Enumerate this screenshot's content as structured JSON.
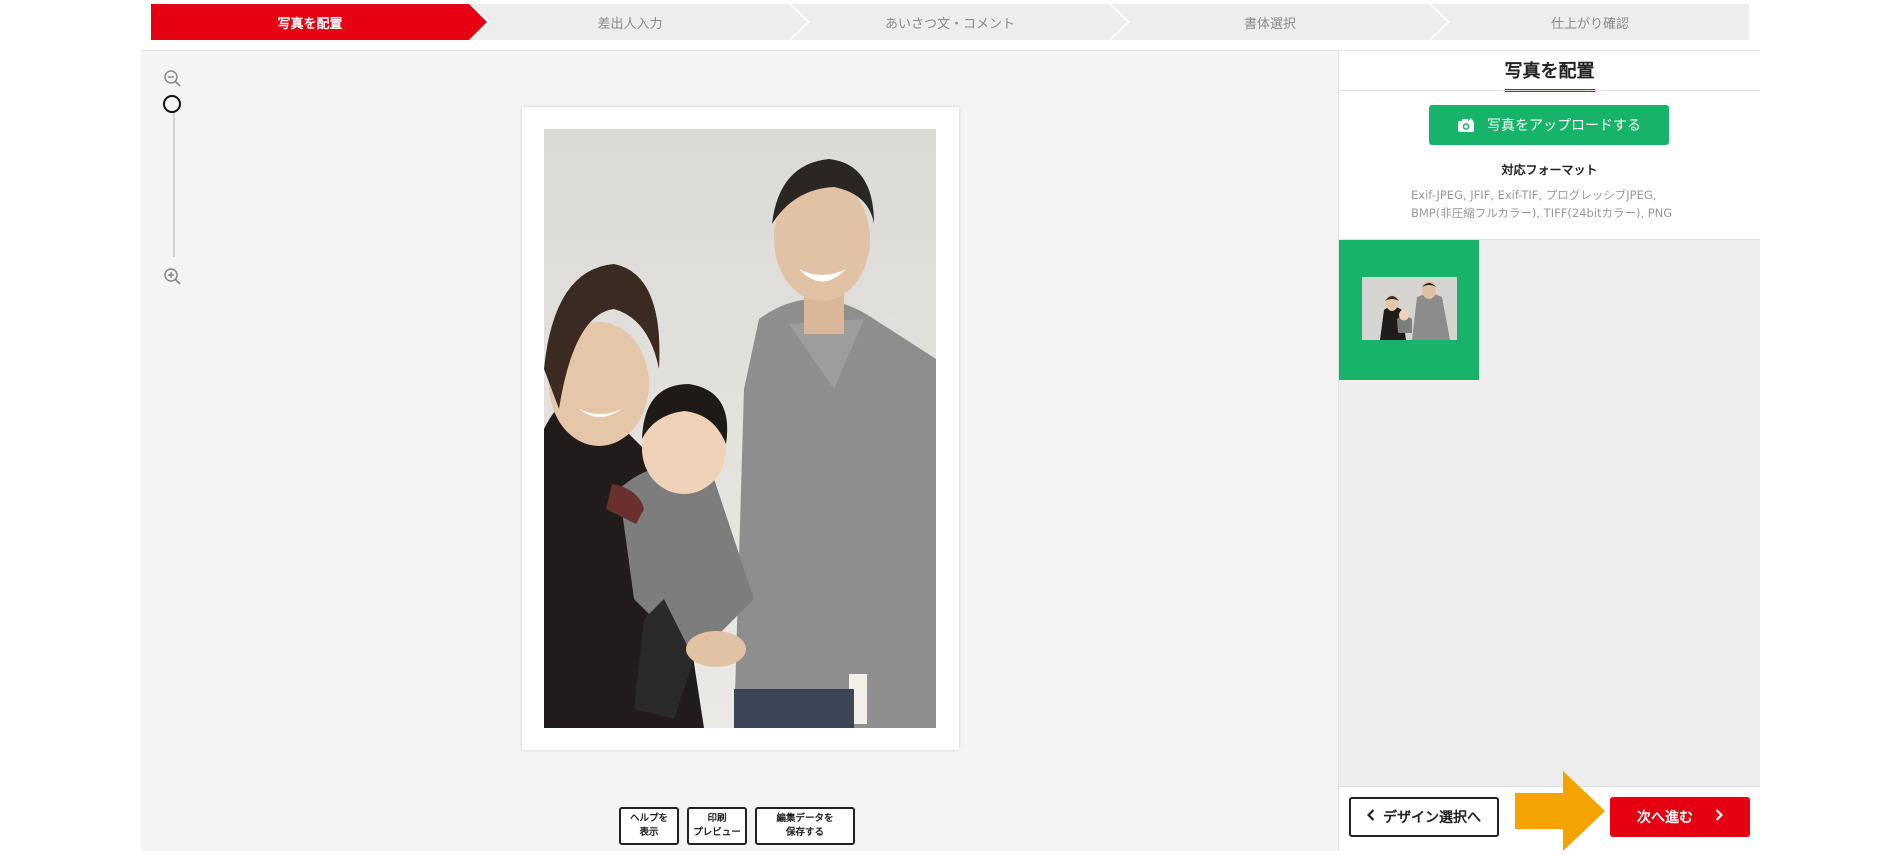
{
  "steps": [
    {
      "label": "写真を配置",
      "active": true
    },
    {
      "label": "差出人入力",
      "active": false
    },
    {
      "label": "あいさつ文・コメント",
      "active": false
    },
    {
      "label": "書体選択",
      "active": false
    },
    {
      "label": "仕上がり確認",
      "active": false
    }
  ],
  "zoom": {
    "level_fraction": 0.0
  },
  "tools": {
    "help": "ヘルプを\n表示",
    "preview": "印刷\nプレビュー",
    "save": "編集データを\n保存する"
  },
  "panel": {
    "title": "写真を配置",
    "upload_label": "写真をアップロードする",
    "formats_title": "対応フォーマット",
    "formats_line1": "Exif-JPEG, JFIF, Exif-TIF, プログレッシブJPEG,",
    "formats_line2": "BMP(非圧縮フルカラー), TIFF(24bitカラー), PNG",
    "back_label": "デザイン選択へ",
    "next_label": "次へ進む"
  },
  "colors": {
    "accent_red": "#e50012",
    "upload_green": "#17b36b",
    "pointer_orange": "#f5a300"
  },
  "icons": [
    "zoom-out-icon",
    "zoom-in-icon",
    "camera-icon",
    "chevron-left-icon",
    "chevron-right-icon",
    "arrow-right-icon"
  ]
}
